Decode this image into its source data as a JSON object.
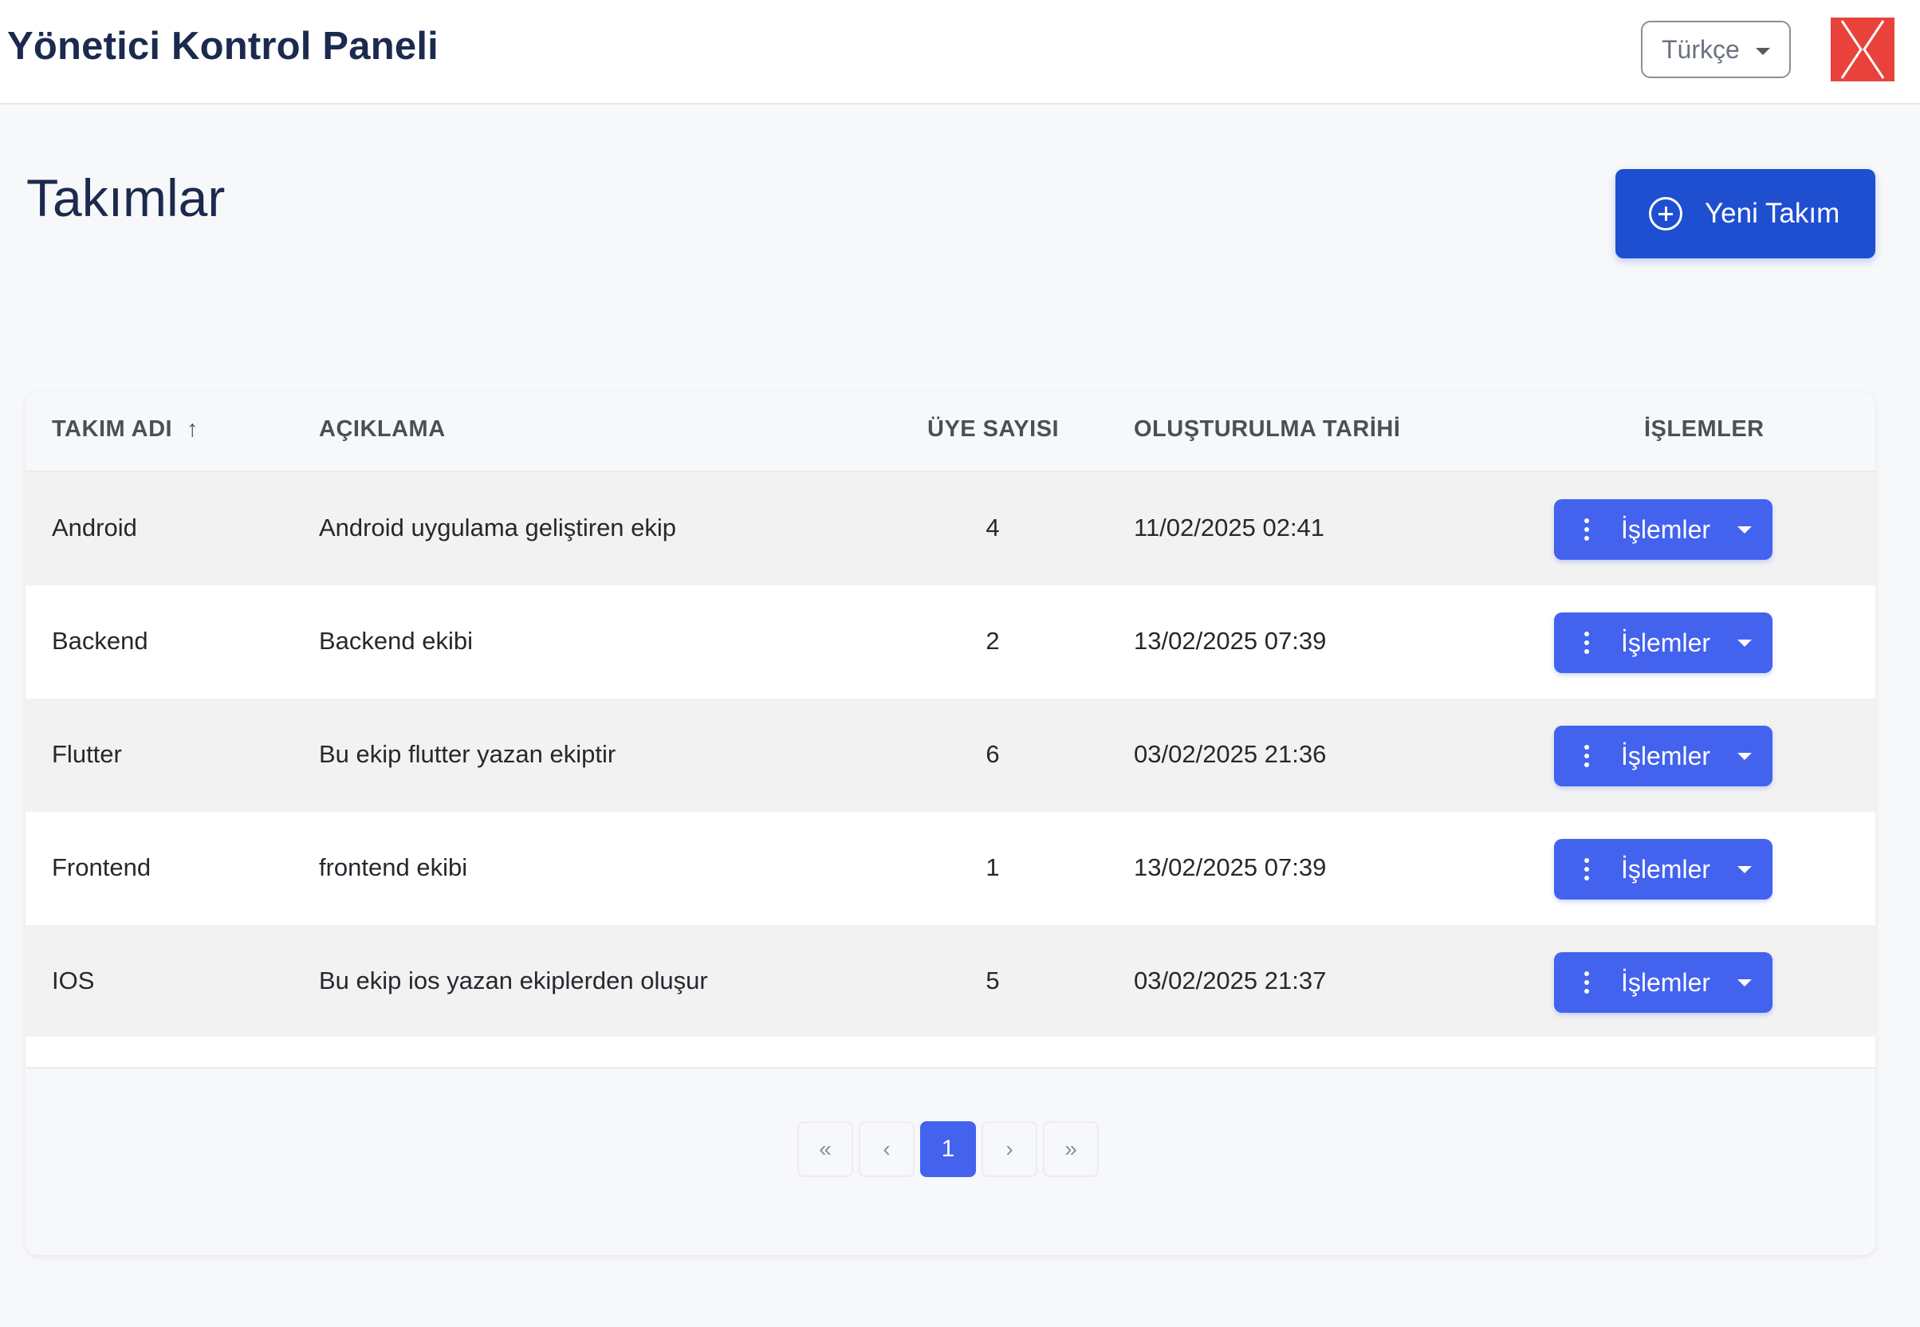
{
  "header": {
    "title": "Yönetici Kontrol Paneli",
    "language": "Türkçe",
    "logo_icon": "brand-x-logo"
  },
  "page": {
    "title": "Takımlar",
    "new_button_label": "Yeni Takım",
    "new_button_icon": "plus-circle-icon"
  },
  "table": {
    "columns": {
      "name": "TAKIM ADI",
      "sort_indicator": "↑",
      "description": "AÇIKLAMA",
      "members": "ÜYE SAYISI",
      "created": "OLUŞTURULMA TARİHİ",
      "actions": "İŞLEMLER"
    },
    "rows": [
      {
        "name": "Android",
        "description": "Android uygulama geliştiren ekip",
        "members": "4",
        "created": "11/02/2025 02:41",
        "action_label": "İşlemler"
      },
      {
        "name": "Backend",
        "description": "Backend ekibi",
        "members": "2",
        "created": "13/02/2025 07:39",
        "action_label": "İşlemler"
      },
      {
        "name": "Flutter",
        "description": "Bu ekip flutter yazan ekiptir",
        "members": "6",
        "created": "03/02/2025 21:36",
        "action_label": "İşlemler"
      },
      {
        "name": "Frontend",
        "description": "frontend ekibi",
        "members": "1",
        "created": "13/02/2025 07:39",
        "action_label": "İşlemler"
      },
      {
        "name": "IOS",
        "description": "Bu ekip ios yazan ekiplerden oluşur",
        "members": "5",
        "created": "03/02/2025 21:37",
        "action_label": "İşlemler"
      }
    ]
  },
  "pagination": {
    "first": "«",
    "prev": "‹",
    "current": "1",
    "next": "›",
    "last": "»"
  },
  "colors": {
    "primary": "#1f4fd1",
    "action": "#4362ee",
    "title": "#1b2a4e",
    "logo": "#e8423a"
  }
}
